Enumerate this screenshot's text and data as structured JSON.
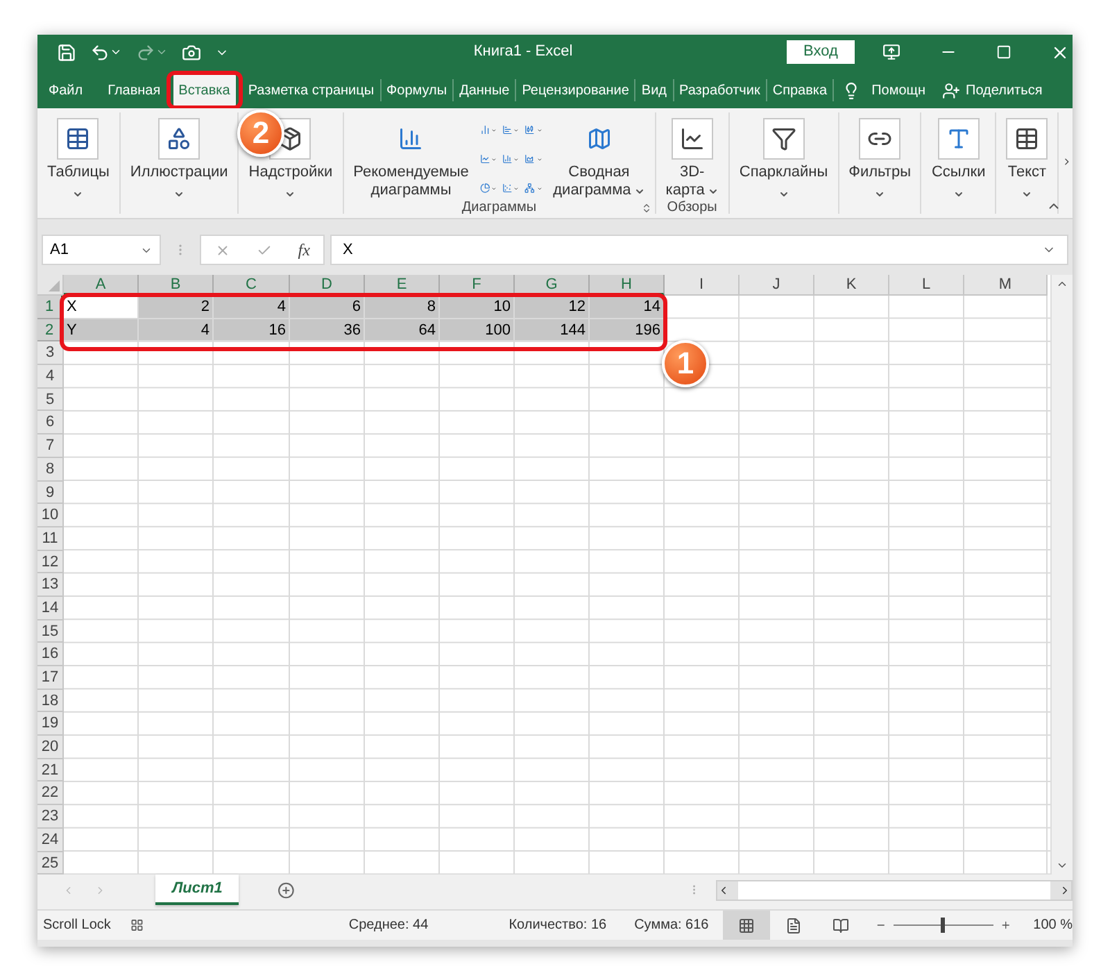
{
  "window": {
    "title": "Книга1 - Excel",
    "sign_in": "Вход"
  },
  "tabs": [
    {
      "label": "Файл",
      "selected": false
    },
    {
      "label": "Главная",
      "selected": false
    },
    {
      "label": "Вставка",
      "selected": true
    },
    {
      "label": "Разметка страницы",
      "selected": false
    },
    {
      "label": "Формулы",
      "selected": false
    },
    {
      "label": "Данные",
      "selected": false
    },
    {
      "label": "Рецензирование",
      "selected": false
    },
    {
      "label": "Вид",
      "selected": false
    },
    {
      "label": "Разработчик",
      "selected": false
    },
    {
      "label": "Справка",
      "selected": false
    }
  ],
  "help": "Помощн",
  "share": "Поделиться",
  "ribbon": {
    "groups": [
      {
        "items": [
          {
            "kind": "large",
            "lines": [
              "Таблицы"
            ],
            "dropdown": true
          }
        ]
      },
      {
        "items": [
          {
            "kind": "large",
            "lines": [
              "Иллюстрации"
            ],
            "dropdown": true
          }
        ]
      },
      {
        "items": [
          {
            "kind": "large",
            "lines": [
              "Надстройки"
            ],
            "dropdown": true
          }
        ]
      },
      {
        "label": "Диаграммы",
        "items": [
          {
            "kind": "large",
            "lines": [
              "Рекомендуемые",
              "диаграммы"
            ],
            "dropdown": false
          },
          {
            "kind": "gallery"
          },
          {
            "kind": "large",
            "lines": [
              "Сводная",
              "диаграмма"
            ],
            "dropdown": true
          }
        ]
      },
      {
        "label": "Обзоры",
        "items": [
          {
            "kind": "large",
            "lines": [
              "3D-",
              "карта"
            ],
            "dropdown": true
          }
        ]
      },
      {
        "items": [
          {
            "kind": "large",
            "lines": [
              "Спарклайны"
            ],
            "dropdown": true
          }
        ]
      },
      {
        "items": [
          {
            "kind": "large",
            "lines": [
              "Фильтры"
            ],
            "dropdown": true
          }
        ]
      },
      {
        "items": [
          {
            "kind": "large",
            "lines": [
              "Ссылки"
            ],
            "dropdown": true
          }
        ]
      },
      {
        "items": [
          {
            "kind": "large",
            "lines": [
              "Текст"
            ],
            "dropdown": true
          }
        ]
      }
    ]
  },
  "formula_bar": {
    "name_box": "A1",
    "function_label": "fx",
    "value": "X"
  },
  "columns": [
    {
      "label": "A",
      "selected": true
    },
    {
      "label": "B",
      "selected": true
    },
    {
      "label": "C",
      "selected": true
    },
    {
      "label": "D",
      "selected": true
    },
    {
      "label": "E",
      "selected": true
    },
    {
      "label": "F",
      "selected": true
    },
    {
      "label": "G",
      "selected": true
    },
    {
      "label": "H",
      "selected": true
    },
    {
      "label": "I",
      "selected": false
    },
    {
      "label": "J",
      "selected": false
    },
    {
      "label": "K",
      "selected": false
    },
    {
      "label": "L",
      "selected": false
    },
    {
      "label": "M",
      "selected": false
    }
  ],
  "rows": [
    {
      "label": "1",
      "selected": true,
      "cells": [
        {
          "value": "X",
          "kind": "text",
          "shaded": false
        },
        {
          "value": "2",
          "kind": "number",
          "shaded": true
        },
        {
          "value": "4",
          "kind": "number",
          "shaded": true
        },
        {
          "value": "6",
          "kind": "number",
          "shaded": true
        },
        {
          "value": "8",
          "kind": "number",
          "shaded": true
        },
        {
          "value": "10",
          "kind": "number",
          "shaded": true
        },
        {
          "value": "12",
          "kind": "number",
          "shaded": true
        },
        {
          "value": "14",
          "kind": "number",
          "shaded": true
        }
      ]
    },
    {
      "label": "2",
      "selected": true,
      "cells": [
        {
          "value": "Y",
          "kind": "text",
          "shaded": true
        },
        {
          "value": "4",
          "kind": "number",
          "shaded": true
        },
        {
          "value": "16",
          "kind": "number",
          "shaded": true
        },
        {
          "value": "36",
          "kind": "number",
          "shaded": true
        },
        {
          "value": "64",
          "kind": "number",
          "shaded": true
        },
        {
          "value": "100",
          "kind": "number",
          "shaded": true
        },
        {
          "value": "144",
          "kind": "number",
          "shaded": true
        },
        {
          "value": "196",
          "kind": "number",
          "shaded": true
        }
      ]
    },
    {
      "label": "3",
      "selected": false
    },
    {
      "label": "4",
      "selected": false
    },
    {
      "label": "5",
      "selected": false
    },
    {
      "label": "6",
      "selected": false
    },
    {
      "label": "7",
      "selected": false
    },
    {
      "label": "8",
      "selected": false
    },
    {
      "label": "9",
      "selected": false
    },
    {
      "label": "10",
      "selected": false
    },
    {
      "label": "11",
      "selected": false
    },
    {
      "label": "12",
      "selected": false
    },
    {
      "label": "13",
      "selected": false
    },
    {
      "label": "14",
      "selected": false
    },
    {
      "label": "15",
      "selected": false
    },
    {
      "label": "16",
      "selected": false
    },
    {
      "label": "17",
      "selected": false
    },
    {
      "label": "18",
      "selected": false
    },
    {
      "label": "19",
      "selected": false
    },
    {
      "label": "20",
      "selected": false
    },
    {
      "label": "21",
      "selected": false
    },
    {
      "label": "22",
      "selected": false
    },
    {
      "label": "23",
      "selected": false
    },
    {
      "label": "24",
      "selected": false
    },
    {
      "label": "25",
      "selected": false
    }
  ],
  "sheets": [
    {
      "label": "Лист1",
      "selected": true
    }
  ],
  "status_bar": {
    "mode": "Scroll Lock",
    "stats": [
      "Среднее: 44",
      "Количество: 16",
      "Сумма: 616"
    ],
    "views": [
      {
        "selected": true
      },
      {
        "selected": false
      },
      {
        "selected": false
      }
    ],
    "zoom": {
      "level": 0.5,
      "reading": "100 %"
    }
  },
  "annotations": [
    {
      "number": "1"
    },
    {
      "number": "2"
    }
  ]
}
